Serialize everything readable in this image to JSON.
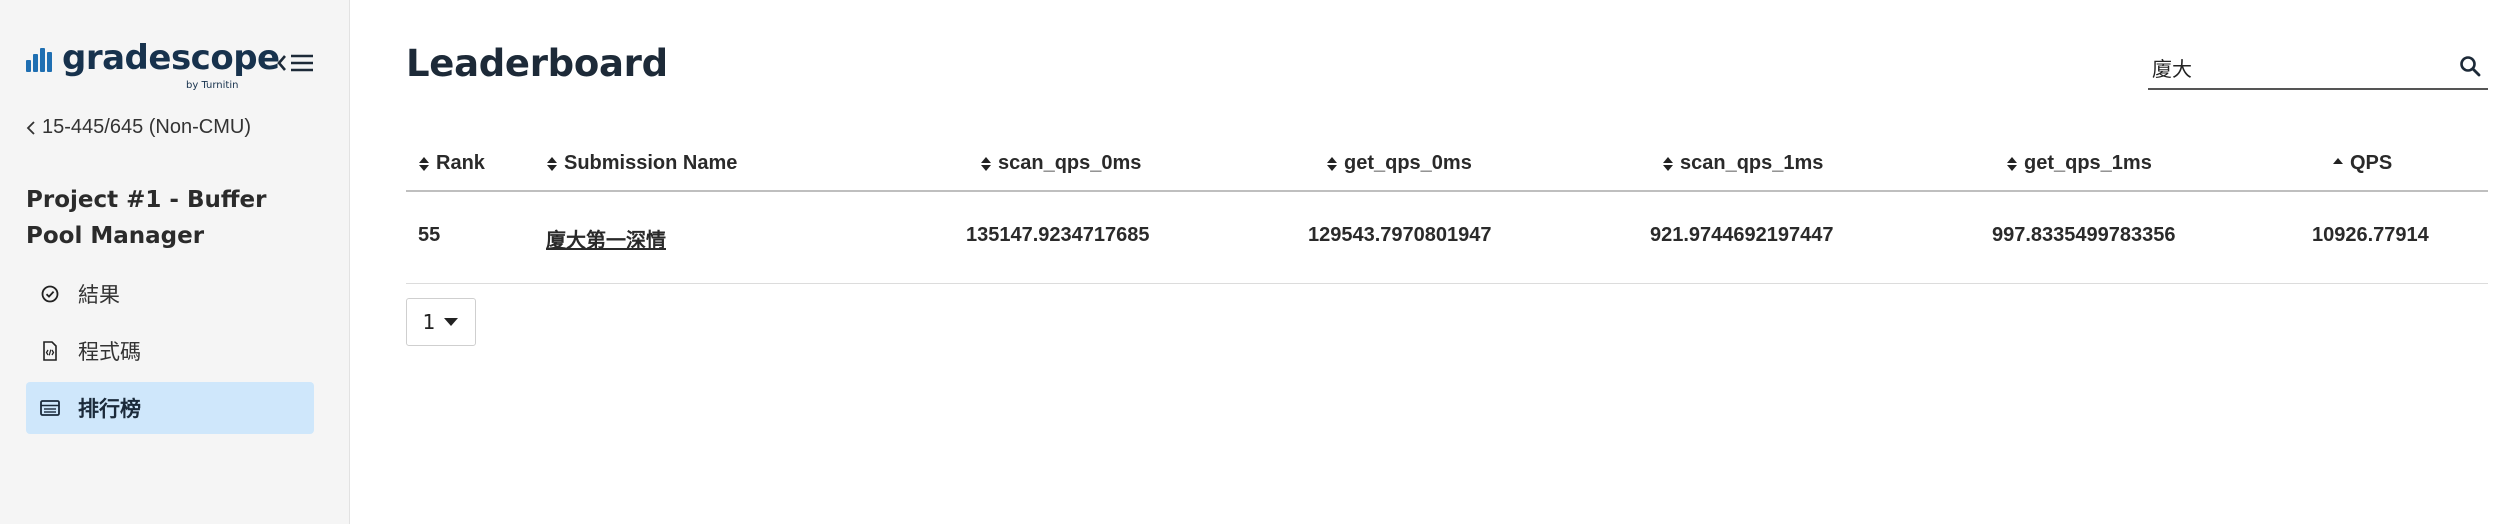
{
  "logo": {
    "wordmark": "gradescope",
    "tagline": "by Turnitin",
    "brand_color": "#1f6fb2"
  },
  "sidebar": {
    "back_link": "15-445/645 (Non-CMU)",
    "course_title": "Project #1 - Buffer Pool Manager",
    "items": [
      {
        "label": "結果",
        "icon": "check-circle-icon",
        "active": false
      },
      {
        "label": "程式碼",
        "icon": "code-file-icon",
        "active": false
      },
      {
        "label": "排行榜",
        "icon": "leaderboard-icon",
        "active": true
      }
    ],
    "active_color": "#cfe7fb"
  },
  "main": {
    "title": "Leaderboard",
    "search": {
      "value": "廈大",
      "placeholder": ""
    }
  },
  "table": {
    "columns": [
      {
        "label": "Rank",
        "sort": "both"
      },
      {
        "label": "Submission Name",
        "sort": "both"
      },
      {
        "label": "scan_qps_0ms",
        "sort": "both"
      },
      {
        "label": "get_qps_0ms",
        "sort": "both"
      },
      {
        "label": "scan_qps_1ms",
        "sort": "both"
      },
      {
        "label": "get_qps_1ms",
        "sort": "both"
      },
      {
        "label": "QPS",
        "sort": "asc"
      }
    ],
    "rows": [
      [
        "55",
        "廈大第一深情",
        "135147.9234717685",
        "129543.7970801947",
        "921.9744692197447",
        "997.8335499783356",
        "10926.77914"
      ]
    ]
  },
  "pager": {
    "current": "1"
  }
}
